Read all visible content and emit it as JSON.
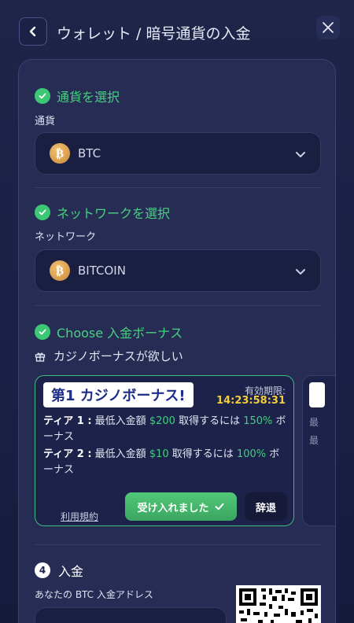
{
  "header": {
    "title": "ウォレット / 暗号通貨の入金"
  },
  "currency_step": {
    "title": "通貨を選択",
    "field_label": "通貨",
    "selected": "BTC",
    "coin_symbol": "₿"
  },
  "network_step": {
    "title": "ネットワークを選択",
    "field_label": "ネットワーク",
    "selected": "BITCOIN",
    "coin_symbol": "₿"
  },
  "bonus_step": {
    "title": "Choose 入金ボーナス",
    "subtitle": "カジノボーナスが欲しい",
    "card": {
      "badge": "第1 カジノボーナス!",
      "expiry_label": "有効期限:",
      "expiry_time": "14:23:58:31",
      "tiers": [
        {
          "label": "ティア 1 :",
          "pre": "最低入金額",
          "amount": "$200",
          "mid": "取得するには",
          "percent": "150%",
          "suffix": "ボーナス"
        },
        {
          "label": "ティア 2 :",
          "pre": "最低入金額",
          "amount": "$10",
          "mid": "取得するには",
          "percent": "100%",
          "suffix": "ボーナス"
        }
      ],
      "terms_label": "利用規約",
      "accept_label": "受け入れました",
      "decline_label": "辞退"
    },
    "peek_card": {
      "line1": "最",
      "line2": "最"
    }
  },
  "deposit_step": {
    "number": "4",
    "title": "入金",
    "address_label": "あなたの BTC 入金アドレス"
  },
  "colors": {
    "accent_green": "#46d27f",
    "expiry_yellow": "#f2cf3a",
    "badge_blue": "#1d2d88"
  }
}
